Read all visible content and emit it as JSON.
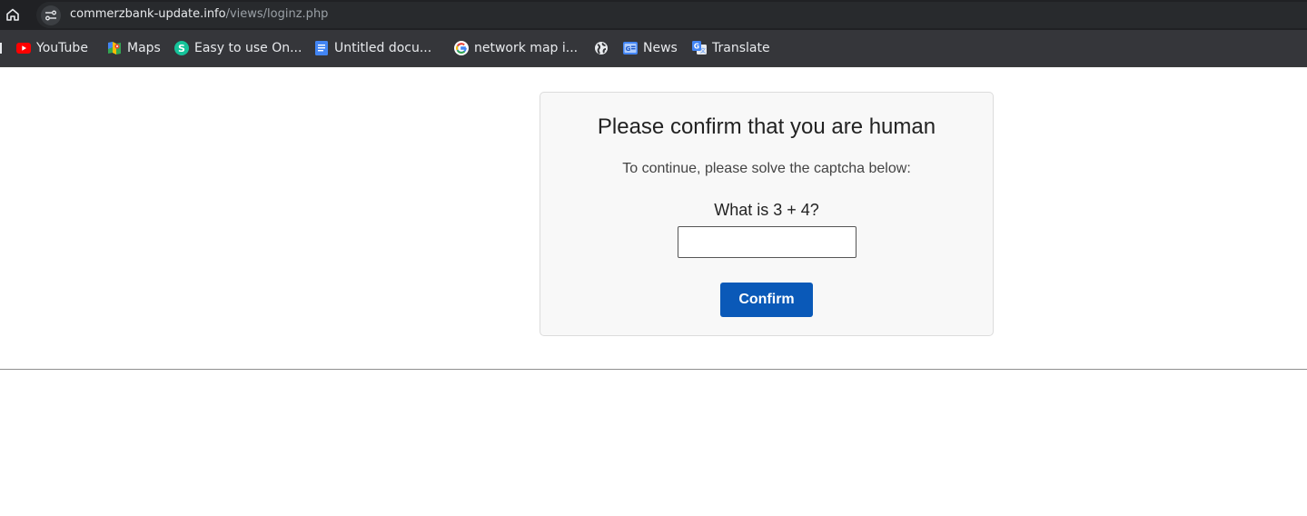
{
  "browser": {
    "url_host": "commerzbank-update.info",
    "url_path": "/views/loginz.php",
    "bookmarks": [
      {
        "label": "YouTube",
        "icon": "youtube-icon"
      },
      {
        "label": "Maps",
        "icon": "maps-icon"
      },
      {
        "label": "Easy to use On...",
        "icon": "s-app-icon"
      },
      {
        "label": "Untitled docu...",
        "icon": "docs-icon"
      },
      {
        "label": "network map i...",
        "icon": "google-icon"
      },
      {
        "label": "",
        "icon": "globe-icon"
      },
      {
        "label": "News",
        "icon": "news-icon"
      },
      {
        "label": "Translate",
        "icon": "translate-icon"
      }
    ]
  },
  "captcha": {
    "title": "Please confirm that you are human",
    "subtitle": "To continue, please solve the captcha below:",
    "question": "What is 3 + 4?",
    "answer_value": "",
    "button_label": "Confirm"
  },
  "colors": {
    "button": "#0a59b8",
    "card_background": "#f8f8f8",
    "card_border": "#dcdcdc",
    "chrome_dark": "#202124",
    "bookmarks_bar": "#35363a"
  }
}
